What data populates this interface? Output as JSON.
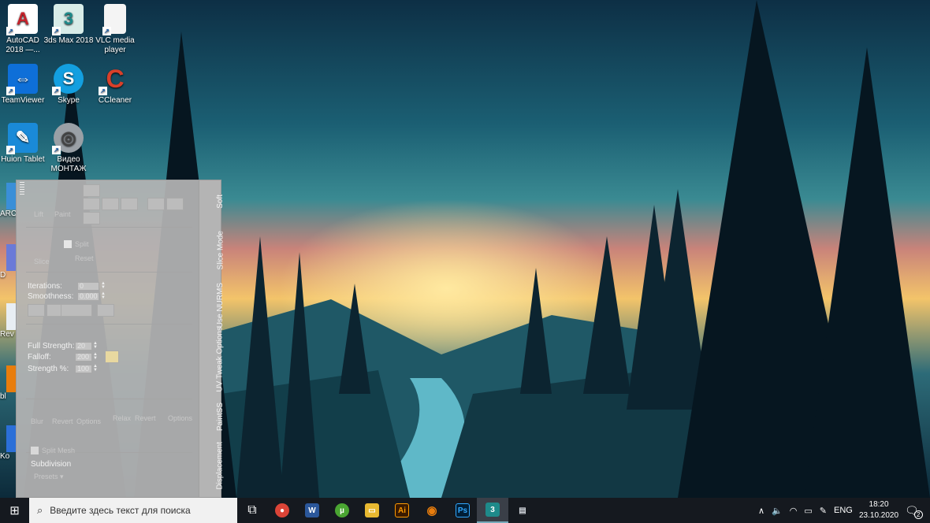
{
  "desktop": {
    "icons": [
      {
        "label": "AutoCAD 2018 —...",
        "glyph": "A",
        "color": "#c4222b"
      },
      {
        "label": "3ds Max 2018",
        "glyph": "3",
        "color": "#1e8a8a"
      },
      {
        "label": "VLC media player",
        "glyph": "",
        "color": "#f4f4f4"
      },
      {
        "label": "TeamViewer",
        "glyph": "⇔",
        "color": "#0e6fd8"
      },
      {
        "label": "Skype",
        "glyph": "S",
        "color": "#139fe0"
      },
      {
        "label": "CCleaner",
        "glyph": "C",
        "color": "#d8402a"
      },
      {
        "label": "Huion Tablet",
        "glyph": "✎",
        "color": "#1a8ad8"
      },
      {
        "label": "Видео МОНТАЖ",
        "glyph": "◎",
        "color": "#9aa0a6"
      }
    ],
    "cut_icons": [
      "ARC",
      "D",
      "Rev",
      "bl",
      "Ko"
    ]
  },
  "panel": {
    "tabs": [
      "Soft",
      "Slice Mode",
      "Use NURMS",
      "UV Tweak Options",
      "PaintSS",
      "Displacement"
    ],
    "ghost_top": [
      "Lift",
      "Paint"
    ],
    "slice": {
      "button": "Slice",
      "split": "Split",
      "reset": "Reset"
    },
    "iterations_label": "Iterations:",
    "iterations": "0",
    "smoothness_label": "Smoothness:",
    "smoothness": "0.000",
    "full_strength_label": "Full Strength:",
    "full_strength": "20",
    "falloff_label": "Falloff:",
    "falloff": "200",
    "strength_label": "Strength %:",
    "strength": "100",
    "paint_buttons": [
      "Blur",
      "Revert",
      "Options",
      "Relax",
      "Revert",
      "Options"
    ],
    "subdivision_check": "Split Mesh",
    "subdivision_label": "Subdivision",
    "presets": "Presets"
  },
  "taskbar": {
    "search_placeholder": "Введите здесь текст для поиска",
    "apps": [
      {
        "name": "chrome",
        "glyph": "●",
        "color": "#db4437"
      },
      {
        "name": "word",
        "glyph": "W",
        "color": "#2b579a"
      },
      {
        "name": "utorrent",
        "glyph": "µ",
        "color": "#4aa532"
      },
      {
        "name": "explorer",
        "glyph": "▭",
        "color": "#e8b931"
      },
      {
        "name": "illustrator",
        "glyph": "Ai",
        "color": "#3a1a00"
      },
      {
        "name": "blender",
        "glyph": "◉",
        "color": "#e87d0d"
      },
      {
        "name": "photoshop",
        "glyph": "Ps",
        "color": "#001e36"
      },
      {
        "name": "3ds-max",
        "glyph": "3",
        "color": "#1e8a8a"
      },
      {
        "name": "other-app",
        "glyph": "▤",
        "color": "#d0d4da"
      }
    ],
    "lang": "ENG",
    "time": "18:20",
    "date": "23.10.2020",
    "notifications": "2"
  }
}
